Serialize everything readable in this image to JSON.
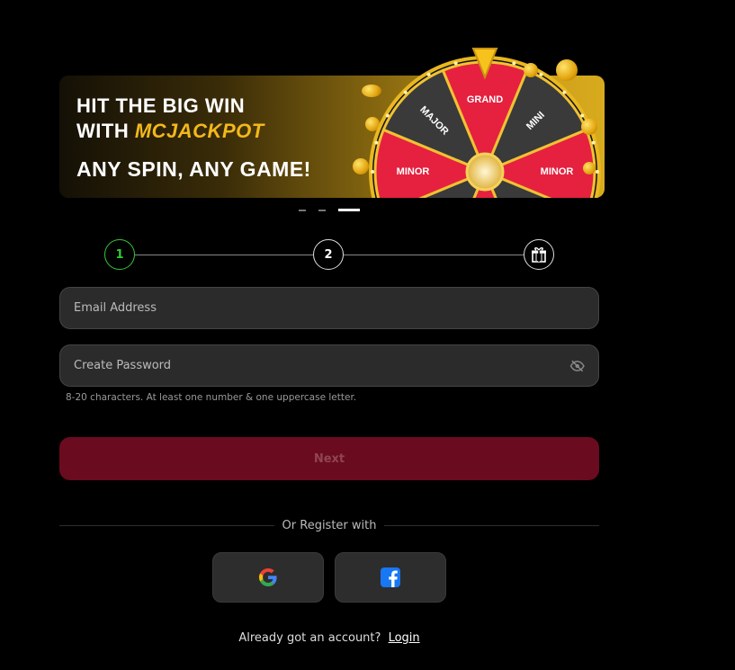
{
  "banner": {
    "line1": "HIT THE BIG WIN",
    "line2_prefix": "WITH",
    "line2_brand": "MCJACKPOT",
    "line3": "ANY SPIN, ANY GAME!",
    "wheel_labels": [
      "GRAND",
      "MINI",
      "MINOR",
      "MAJOR",
      "GR",
      "MINI",
      "MINOR",
      "MAJOR"
    ]
  },
  "pager": {
    "count": 3,
    "active_index": 2
  },
  "stepper": {
    "steps": [
      {
        "label": "1",
        "state": "active"
      },
      {
        "label": "2",
        "state": "pending"
      },
      {
        "icon": "gift-icon",
        "state": "pending"
      }
    ]
  },
  "form": {
    "email": {
      "placeholder": "Email Address",
      "value": ""
    },
    "password": {
      "placeholder": "Create Password",
      "value": "",
      "toggle_icon": "eye-off-icon"
    },
    "password_hint": "8-20 characters. At least one number & one uppercase letter.",
    "next_label": "Next"
  },
  "social": {
    "divider_text": "Or Register with",
    "providers": [
      {
        "name": "google",
        "icon": "google-icon"
      },
      {
        "name": "facebook",
        "icon": "facebook-icon"
      }
    ]
  },
  "footer": {
    "prompt": "Already got an account?",
    "login_label": "Login"
  },
  "colors": {
    "accent_green": "#33cc33",
    "next_button": "#6b0b1f",
    "brand_gold": "#f3b81a",
    "wheel_red": "#e5213f",
    "wheel_dark": "#3a3a3a"
  }
}
